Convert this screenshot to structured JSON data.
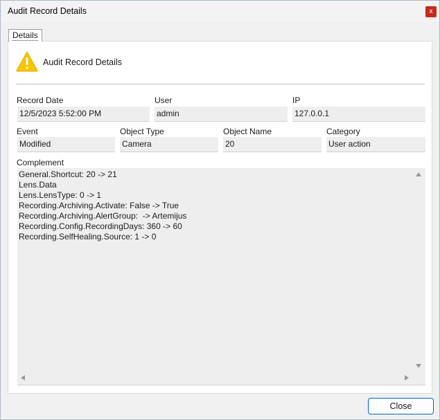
{
  "window": {
    "title": "Audit Record Details",
    "close_glyph": "x"
  },
  "tabs": [
    {
      "label": "Details",
      "selected": true
    }
  ],
  "header": {
    "icon": "warning-icon",
    "title": "Audit Record Details"
  },
  "fields": {
    "record_date": {
      "label": "Record Date",
      "value": "12/5/2023 5:52:00 PM"
    },
    "user": {
      "label": "User",
      "value": "admin"
    },
    "ip": {
      "label": "IP",
      "value": "127.0.0.1"
    },
    "event": {
      "label": "Event",
      "value": "Modified"
    },
    "object_type": {
      "label": "Object Type",
      "value": "Camera"
    },
    "object_name": {
      "label": "Object Name",
      "value": "20"
    },
    "category": {
      "label": "Category",
      "value": "User action"
    }
  },
  "complement": {
    "label": "Complement",
    "lines": [
      "General.Shortcut: 20 -> 21",
      "Lens.Data",
      "Lens.LensType: 0 -> 1",
      "Recording.Archiving.Activate: False -> True",
      "Recording.Archiving.AlertGroup:  -> Artemijus",
      "Recording.Config.RecordingDays: 360 -> 60",
      "Recording.SelfHealing.Source: 1 -> 0"
    ]
  },
  "buttons": {
    "close_label": "Close"
  },
  "colors": {
    "warning": "#f7c600",
    "accent": "#0067c0",
    "title_close": "#c42b1c"
  }
}
